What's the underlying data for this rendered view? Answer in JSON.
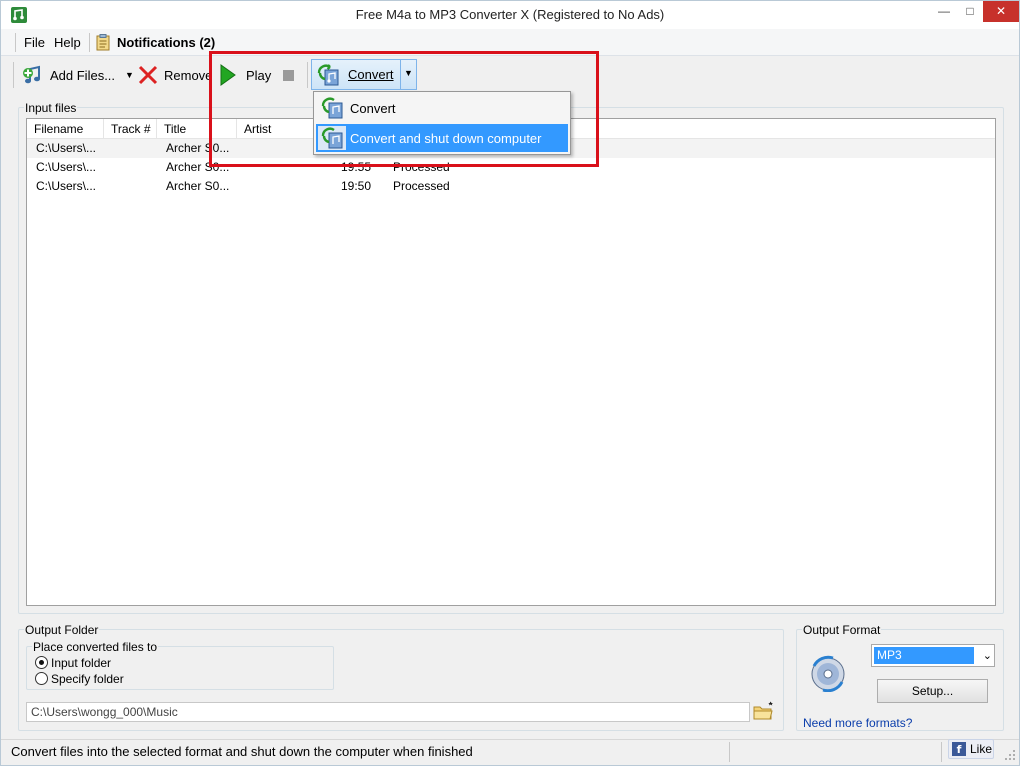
{
  "window": {
    "title": "Free M4a to MP3 Converter X (Registered to No Ads)"
  },
  "menu": {
    "file": "File",
    "help": "Help",
    "notifications": "Notifications (2)"
  },
  "toolbar": {
    "add_files": "Add Files...",
    "remove": "Remove",
    "play": "Play",
    "convert": "Convert"
  },
  "convert_menu": {
    "items": [
      "Convert",
      "Convert and shut down computer"
    ],
    "highlighted": "Convert and shut down computer"
  },
  "input_files": {
    "label": "Input files",
    "columns": [
      "Filename",
      "Track #",
      "Title",
      "Artist"
    ],
    "rows": [
      {
        "filename": "C:\\Users\\...",
        "track": "",
        "title": "Archer S0...",
        "artist": "",
        "time": "",
        "status": ""
      },
      {
        "filename": "C:\\Users\\...",
        "track": "",
        "title": "Archer S0...",
        "artist": "",
        "time": "19:55",
        "status": "Processed"
      },
      {
        "filename": "C:\\Users\\...",
        "track": "",
        "title": "Archer S0...",
        "artist": "",
        "time": "19:50",
        "status": "Processed"
      }
    ]
  },
  "output_folder": {
    "label": "Output Folder",
    "place_label": "Place converted files to",
    "option_input": "Input folder",
    "option_specify": "Specify folder",
    "selected": "Input folder",
    "path": "C:\\Users\\wongg_000\\Music"
  },
  "output_format": {
    "label": "Output Format",
    "selected": "MP3",
    "setup_label": "Setup...",
    "more_link": "Need more formats?"
  },
  "status": {
    "text": "Convert files into the selected format and shut down the computer when finished",
    "like": "Like"
  },
  "colors": {
    "accent": "#3399ff",
    "highlight_border": "#d9101a",
    "close": "#c7312b"
  }
}
